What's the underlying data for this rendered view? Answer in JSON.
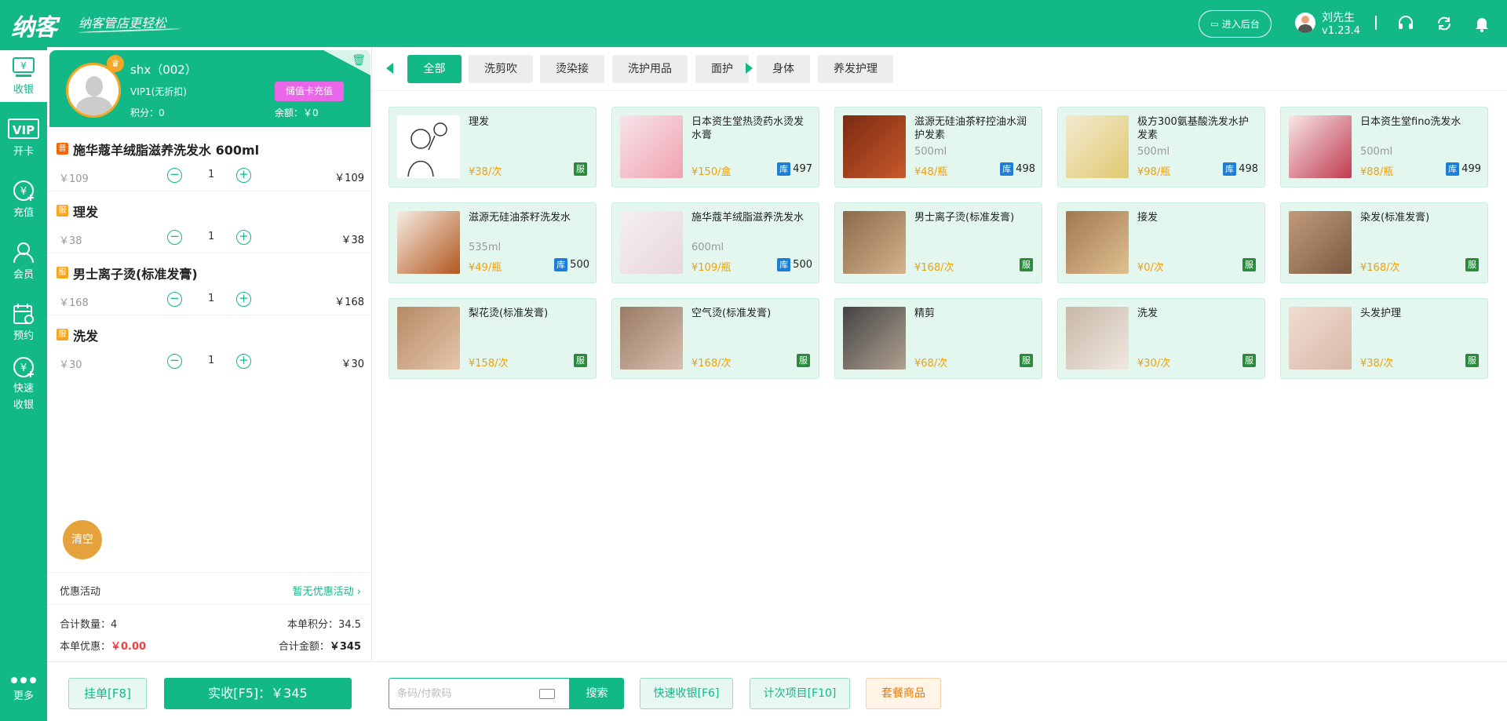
{
  "header": {
    "logo": "纳客",
    "slogan": "纳客管店更轻松",
    "backend_button": "进入后台",
    "user_name": "刘先生",
    "version": "v1.23.4"
  },
  "sidebar": {
    "items": [
      {
        "label": "收银",
        "icon": "cashier-icon"
      },
      {
        "label": "开卡",
        "icon": "vip-card-icon"
      },
      {
        "label": "充值",
        "icon": "recharge-icon"
      },
      {
        "label": "会员",
        "icon": "member-icon"
      },
      {
        "label": "预约",
        "icon": "appointment-icon"
      },
      {
        "label": "快速收银",
        "icon": "quick-cashier-icon"
      }
    ],
    "more": "更多"
  },
  "member": {
    "name": "shx（002）",
    "level": "VIP1(无折扣)",
    "points": "积分：0",
    "balance": "余额：￥0",
    "recharge_button": "储值卡充值"
  },
  "cart": [
    {
      "badge": "普",
      "badge_color": "#f76707",
      "title": "施华蔻羊绒脂滋养洗发水 600ml",
      "unit_price": "￥109",
      "qty": "1",
      "total": "￥109"
    },
    {
      "badge": "服",
      "badge_color": "#f5a623",
      "title": "理发",
      "unit_price": "￥38",
      "qty": "1",
      "total": "￥38"
    },
    {
      "badge": "服",
      "badge_color": "#f5a623",
      "title": "男士离子烫(标准发膏)",
      "unit_price": "￥168",
      "qty": "1",
      "total": "￥168"
    },
    {
      "badge": "服",
      "badge_color": "#f5a623",
      "title": "洗发",
      "unit_price": "￥30",
      "qty": "1",
      "total": "￥30"
    }
  ],
  "clear_button": "清空",
  "promo": {
    "label": "优惠活动",
    "value": "暂无优惠活动"
  },
  "summary": {
    "count_label": "合计数量：",
    "count": "4",
    "points_label": "本单积分：",
    "points": "34.5",
    "discount_label": "本单优惠：",
    "discount": "￥0.00",
    "amount_label": "合计金额：",
    "amount": "￥345"
  },
  "hang_button": "挂单[F8]",
  "pay_button": "实收[F5]：￥345",
  "tabs": [
    "全部",
    "洗剪吹",
    "烫染接",
    "洗护用品",
    "面护",
    "身体",
    "养发护理"
  ],
  "products": [
    {
      "name": "理发",
      "spec": "",
      "price": "¥38/次",
      "tag": "服",
      "stock": ""
    },
    {
      "name": "日本资生堂热烫药水烫发水膏",
      "spec": "",
      "price": "¥150/盒",
      "tag": "库",
      "stock": "497"
    },
    {
      "name": "滋源无硅油茶籽控油水润护发素",
      "spec": "500ml",
      "price": "¥48/瓶",
      "tag": "库",
      "stock": "498"
    },
    {
      "name": "极方300氨基酸洗发水护发素",
      "spec": "500ml",
      "price": "¥98/瓶",
      "tag": "库",
      "stock": "498"
    },
    {
      "name": "日本资生堂fino洗发水",
      "spec": "500ml",
      "price": "¥88/瓶",
      "tag": "库",
      "stock": "499"
    },
    {
      "name": "滋源无硅油茶籽洗发水",
      "spec": "535ml",
      "price": "¥49/瓶",
      "tag": "库",
      "stock": "500"
    },
    {
      "name": "施华蔻羊绒脂滋养洗发水",
      "spec": "600ml",
      "price": "¥109/瓶",
      "tag": "库",
      "stock": "500"
    },
    {
      "name": "男士离子烫(标准发膏)",
      "spec": "",
      "price": "¥168/次",
      "tag": "服",
      "stock": ""
    },
    {
      "name": "接发",
      "spec": "",
      "price": "¥0/次",
      "tag": "服",
      "stock": ""
    },
    {
      "name": "染发(标准发膏)",
      "spec": "",
      "price": "¥168/次",
      "tag": "服",
      "stock": ""
    },
    {
      "name": "梨花烫(标准发膏)",
      "spec": "",
      "price": "¥158/次",
      "tag": "服",
      "stock": ""
    },
    {
      "name": "空气烫(标准发膏)",
      "spec": "",
      "price": "¥168/次",
      "tag": "服",
      "stock": ""
    },
    {
      "name": "精剪",
      "spec": "",
      "price": "¥68/次",
      "tag": "服",
      "stock": ""
    },
    {
      "name": "洗发",
      "spec": "",
      "price": "¥30/次",
      "tag": "服",
      "stock": ""
    },
    {
      "name": "头发护理",
      "spec": "",
      "price": "¥38/次",
      "tag": "服",
      "stock": ""
    }
  ],
  "barcode": {
    "placeholder": "条码/付款码"
  },
  "search_button": "搜索",
  "actions": [
    "快速收银[F6]",
    "计次项目[F10]",
    "套餐商品"
  ],
  "colors": {
    "primary": "#12b886",
    "accent_orange": "#f59f00",
    "recharge_pink": "#e966e9"
  }
}
